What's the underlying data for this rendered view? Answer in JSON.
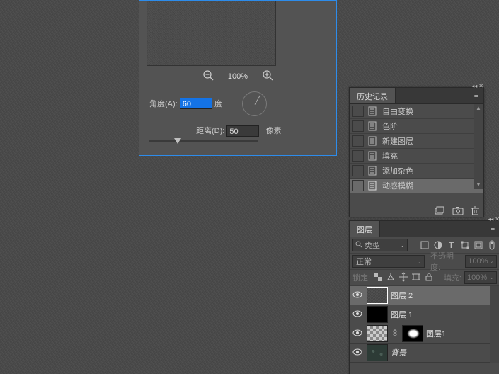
{
  "dialog": {
    "zoom_pct": "100%",
    "angle_label": "角度(A):",
    "angle_value": "60",
    "angle_unit": "度",
    "distance_label": "距离(D):",
    "distance_value": "50",
    "distance_unit": "像素"
  },
  "history": {
    "tab": "历史记录",
    "items": [
      {
        "label": "自由变换"
      },
      {
        "label": "色阶"
      },
      {
        "label": "新建图层"
      },
      {
        "label": "填充"
      },
      {
        "label": "添加杂色"
      },
      {
        "label": "动感模糊"
      }
    ]
  },
  "layers": {
    "tab": "图层",
    "search_placeholder": "类型",
    "blend_mode": "正常",
    "opacity_label": "不透明度:",
    "opacity_value": "100%",
    "lock_label": "锁定:",
    "fill_label": "填充:",
    "fill_value": "100%",
    "items": [
      {
        "name": "图层 2"
      },
      {
        "name": "图层 1"
      },
      {
        "name": "图层1"
      },
      {
        "name": "背景"
      }
    ]
  }
}
